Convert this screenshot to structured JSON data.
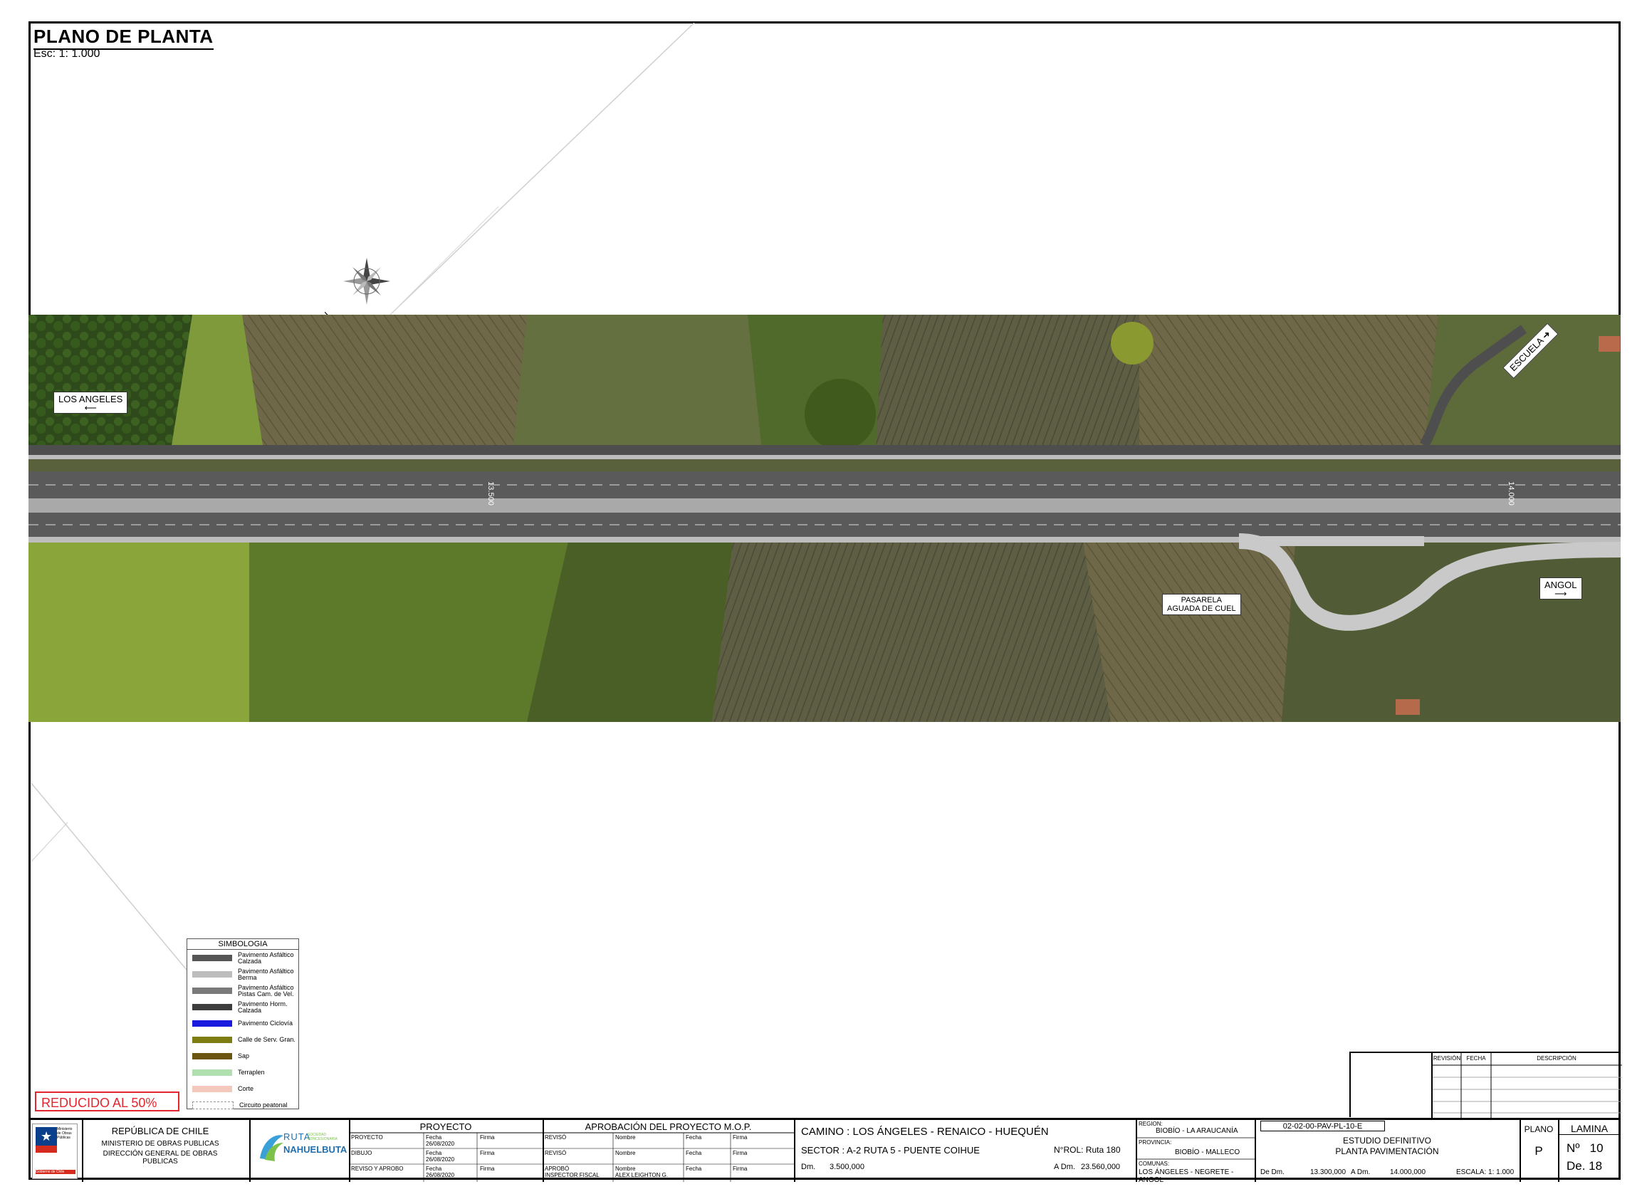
{
  "header": {
    "title": "PLANO DE PLANTA",
    "scale": "Esc: 1: 1.000"
  },
  "map": {
    "north_marker": "N",
    "labels": {
      "los_angeles": "LOS ANGELES",
      "angol": "ANGOL",
      "escuela": "ESCUELA",
      "pasarela_line1": "PASARELA",
      "pasarela_line2": "AGUADA DE CUEL"
    },
    "chainage": {
      "left": "13.500",
      "right": "14.000"
    }
  },
  "legend": {
    "title": "SIMBOLOGIA",
    "items": [
      {
        "label": "Pavimento Asfáltico Calzada",
        "color": "#555555"
      },
      {
        "label": "Pavimento Asfáltico Berma",
        "color": "#bdbdbd"
      },
      {
        "label": "Pavimento Asfáltico Pistas Cam. de Vel.",
        "color": "#7a7a7a"
      },
      {
        "label": "Pavimento Horm. Calzada",
        "color": "#3d3d3d"
      },
      {
        "label": "Pavimento Ciclovía",
        "color": "#1a1adf"
      },
      {
        "label": "Calle de Serv. Gran.",
        "color": "#7d7d12"
      },
      {
        "label": "Sap",
        "color": "#6b5410"
      },
      {
        "label": "Terraplen",
        "color": "#8fd18f"
      },
      {
        "label": "Corte",
        "color": "#f0b0a0"
      },
      {
        "label": "Circuito peatonal",
        "color": "#ffffff"
      }
    ]
  },
  "stamp": "REDUCIDO AL 50%",
  "revision_table": {
    "headers": [
      "REVISIÓN",
      "FECHA",
      "DESCRIPCIÓN"
    ]
  },
  "title_block": {
    "republic": "REPÚBLICA DE CHILE",
    "ministry": "MINISTERIO DE OBRAS PUBLICAS",
    "direction": "DIRECCIÓN GENERAL DE OBRAS PUBLICAS",
    "gov_logo_text": "Ministerio de Obras Públicas",
    "gov_logo_footer": "Gobierno de Chile",
    "company_main": "RUTA",
    "company_name": "NAHUELBUTA",
    "company_sub": "SOCIEDAD CONCESIONARIA",
    "proyecto": {
      "title": "PROYECTO",
      "rows": [
        {
          "role": "PROYECTO",
          "fecha_label": "Fecha",
          "fecha": "26/08/2020",
          "firma": "Firma"
        },
        {
          "role": "DIBUJO",
          "fecha_label": "Fecha",
          "fecha": "26/08/2020",
          "firma": "Firma"
        },
        {
          "role": "REVISO Y APROBO",
          "fecha_label": "Fecha",
          "fecha": "26/08/2020",
          "firma": "Firma"
        }
      ]
    },
    "aprobacion": {
      "title": "APROBACIÓN DEL PROYECTO M.O.P.",
      "rows": [
        {
          "role": "REVISÓ",
          "nombre": "Nombre",
          "fecha": "Fecha",
          "firma": "Firma"
        },
        {
          "role": "REVISÓ",
          "nombre": "Nombre",
          "fecha": "Fecha",
          "firma": "Firma"
        },
        {
          "role": "APROBÓ",
          "role2": "INSPECTOR FISCAL",
          "nombre": "Nombre",
          "nombre2": "ALEX LEIGHTON G.",
          "fecha": "Fecha",
          "firma": "Firma"
        }
      ]
    },
    "camino": "CAMINO : LOS ÁNGELES - RENAICO - HUEQUÉN",
    "sector": "SECTOR : A-2  RUTA 5 - PUENTE COIHUE",
    "rol": "N°ROL: Ruta 180",
    "dm_label": "Dm.",
    "dm_value": "3.500,000",
    "adm_label": "A Dm.",
    "adm_value": "23.560,000",
    "region_label": "REGION:",
    "region": "BIOBÍO - LA ARAUCANÍA",
    "provincia_label": "PROVINCIA:",
    "provincia": "BIOBÍO - MALLECO",
    "comunas_label": "COMUNAS:",
    "comunas": "LOS ÁNGELES - NEGRETE - ANGOL",
    "code": "02-02-00-PAV-PL-10-E",
    "estudio": "ESTUDIO DEFINITIVO",
    "planta": "PLANTA PAVIMENTACIÓN",
    "de_dm_label": "De Dm.",
    "de_dm": "13.300,000",
    "a_dm_label": "A Dm.",
    "a_dm": "14.000,000",
    "escala": "ESCALA: 1: 1.000",
    "plano_label": "PLANO",
    "plano_value": "P",
    "lamina_label": "LAMINA",
    "lamina_no": "Nº   10",
    "lamina_de": "De. 18"
  }
}
